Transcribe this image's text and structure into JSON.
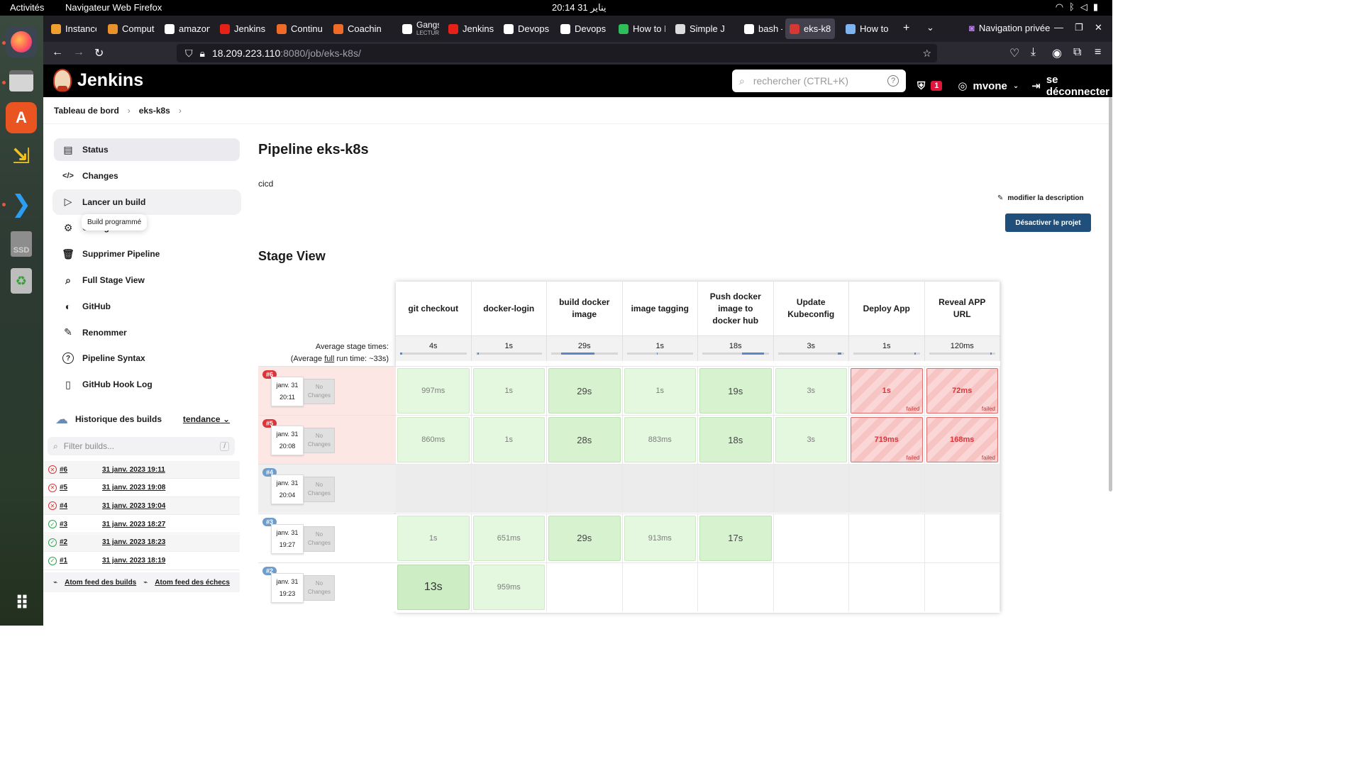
{
  "topbar": {
    "activities": "Activités",
    "app_name": "Navigateur Web Firefox",
    "clock": "20:14  31 يناير"
  },
  "browser": {
    "tabs": [
      {
        "label": "Instance",
        "color": "#f0a030"
      },
      {
        "label": "Comput",
        "color": "#e8912d"
      },
      {
        "label": "amazon",
        "color": "#ffffff"
      },
      {
        "label": "Jenkins",
        "color": "#e62117"
      },
      {
        "label": "Continu",
        "color": "#f06b27"
      },
      {
        "label": "Coachin",
        "color": "#f06b27"
      },
      {
        "label": "Gangste",
        "sub": "LECTURE E",
        "color": "#ffffff"
      },
      {
        "label": "Jenkins",
        "color": "#e62117"
      },
      {
        "label": "Devops",
        "color": "#ffffff"
      },
      {
        "label": "Devops",
        "color": "#ffffff"
      },
      {
        "label": "How to I",
        "color": "#2fbd5a"
      },
      {
        "label": "Simple J",
        "color": "#dcdcdc"
      },
      {
        "label": "bash - H",
        "color": "#ffffff"
      },
      {
        "label": "eks-k8",
        "color": "#d33833"
      },
      {
        "label": "How to",
        "color": "#7cb3f0"
      }
    ],
    "private_label": "Navigation privée",
    "url_host": "18.209.223.110",
    "url_rest": ":8080/job/eks-k8s/"
  },
  "jenkins": {
    "brand": "Jenkins",
    "search_placeholder": "rechercher (CTRL+K)",
    "alert_count": "1",
    "user": "mvone",
    "logout": "se déconnecter"
  },
  "breadcrumb": [
    "Tableau de bord",
    "eks-k8s"
  ],
  "sidebar": {
    "items": [
      {
        "label": "Status",
        "icon": "document-icon"
      },
      {
        "label": "Changes",
        "icon": "code-icon"
      },
      {
        "label": "Lancer un build",
        "icon": "play-icon"
      },
      {
        "label": "Configurer",
        "icon": "gear-icon"
      },
      {
        "label": "Supprimer Pipeline",
        "icon": "trash-icon"
      },
      {
        "label": "Full Stage View",
        "icon": "search-icon"
      },
      {
        "label": "GitHub",
        "icon": "github-icon"
      },
      {
        "label": "Renommer",
        "icon": "pencil-icon"
      },
      {
        "label": "Pipeline Syntax",
        "icon": "help-icon"
      },
      {
        "label": "GitHub Hook Log",
        "icon": "clipboard-icon"
      }
    ],
    "tooltip": "Build programmé"
  },
  "history": {
    "title": "Historique des builds",
    "trend": "tendance",
    "filter_placeholder": "Filter builds...",
    "filter_key": "/",
    "builds": [
      {
        "num": "#6",
        "date": "31 janv. 2023 19:11",
        "status": "failed"
      },
      {
        "num": "#5",
        "date": "31 janv. 2023 19:08",
        "status": "failed"
      },
      {
        "num": "#4",
        "date": "31 janv. 2023 19:04",
        "status": "failed"
      },
      {
        "num": "#3",
        "date": "31 janv. 2023 18:27",
        "status": "success"
      },
      {
        "num": "#2",
        "date": "31 janv. 2023 18:23",
        "status": "success"
      },
      {
        "num": "#1",
        "date": "31 janv. 2023 18:19",
        "status": "success"
      }
    ],
    "feed_all": "Atom feed des builds",
    "feed_fail": "Atom feed des échecs"
  },
  "main": {
    "title": "Pipeline eks-k8s",
    "description": "cicd",
    "edit_description": "modifier la description",
    "disable_button": "Désactiver le projet",
    "stage_view_title": "Stage View"
  },
  "stage_view": {
    "avg_label_1": "Average stage times:",
    "avg_label_2a": "(Average ",
    "avg_label_2b": "full",
    "avg_label_2c": " run time: ~33s)",
    "stages": [
      {
        "name": "git checkout",
        "avg": "4s",
        "bar_frac": 0.03
      },
      {
        "name": "docker-login",
        "avg": "1s",
        "bar_frac": 0.01
      },
      {
        "name": "build docker image",
        "avg": "29s",
        "bar_frac": 0.5
      },
      {
        "name": "image tagging",
        "avg": "1s",
        "bar_frac": 0.01
      },
      {
        "name": "Push docker image to docker hub",
        "avg": "18s",
        "bar_frac": 0.33
      },
      {
        "name": "Update Kubeconfig",
        "avg": "3s",
        "bar_frac": 0.06
      },
      {
        "name": "Deploy App",
        "avg": "1s",
        "bar_frac": 0.01
      },
      {
        "name": "Reveal APP URL",
        "avg": "120ms",
        "bar_frac": 0.01
      }
    ],
    "failed_label": "failed",
    "no_changes_1": "No",
    "no_changes_2": "Changes",
    "builds": [
      {
        "num": "#6",
        "date": "janv. 31",
        "time": "20:11",
        "state": "failed",
        "cells": [
          [
            "997ms",
            "ok"
          ],
          [
            "1s",
            "ok"
          ],
          [
            "29s",
            "ok2"
          ],
          [
            "1s",
            "ok"
          ],
          [
            "19s",
            "ok2"
          ],
          [
            "3s",
            "ok"
          ],
          [
            "1s",
            "fail"
          ],
          [
            "72ms",
            "fail"
          ]
        ]
      },
      {
        "num": "#5",
        "date": "janv. 31",
        "time": "20:08",
        "state": "failed",
        "cells": [
          [
            "860ms",
            "ok"
          ],
          [
            "1s",
            "ok"
          ],
          [
            "28s",
            "ok2"
          ],
          [
            "883ms",
            "ok"
          ],
          [
            "18s",
            "ok2"
          ],
          [
            "3s",
            "ok"
          ],
          [
            "719ms",
            "fail"
          ],
          [
            "168ms",
            "fail"
          ]
        ]
      },
      {
        "num": "#4",
        "date": "janv. 31",
        "time": "20:04",
        "state": "aborted",
        "cells": [
          [
            "",
            ""
          ],
          [
            "",
            ""
          ],
          [
            "",
            ""
          ],
          [
            "",
            ""
          ],
          [
            "",
            ""
          ],
          [
            "",
            ""
          ],
          [
            "",
            ""
          ],
          [
            "",
            ""
          ]
        ]
      },
      {
        "num": "#3",
        "date": "janv. 31",
        "time": "19:27",
        "state": "success",
        "cells": [
          [
            "1s",
            "ok"
          ],
          [
            "651ms",
            "ok"
          ],
          [
            "29s",
            "ok2"
          ],
          [
            "913ms",
            "ok"
          ],
          [
            "17s",
            "ok2"
          ],
          [
            "",
            ""
          ],
          [
            "",
            ""
          ],
          [
            "",
            ""
          ]
        ]
      },
      {
        "num": "#2",
        "date": "janv. 31",
        "time": "19:23",
        "state": "success",
        "cells": [
          [
            "13s",
            "ok3"
          ],
          [
            "959ms",
            "ok"
          ],
          [
            "",
            ""
          ],
          [
            "",
            ""
          ],
          [
            "",
            ""
          ],
          [
            "",
            ""
          ],
          [
            "",
            ""
          ],
          [
            "",
            ""
          ]
        ]
      }
    ]
  },
  "colors": {
    "failed_row": "#fde7e5",
    "aborted_row": "#efefef",
    "num_failed": "#d9353b",
    "num_other": "#6f9ccb",
    "accent": "#1f4f7a"
  }
}
